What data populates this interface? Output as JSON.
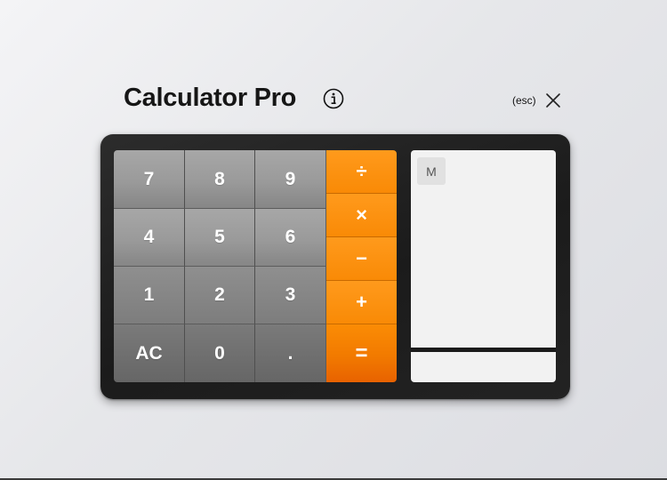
{
  "app": {
    "title": "Calculator Pro",
    "info_icon": "info-circle-icon",
    "esc_hint": "(esc)",
    "close_icon": "close-x-icon"
  },
  "keypad": {
    "digit_keys": [
      {
        "label": "7",
        "name": "key-7"
      },
      {
        "label": "8",
        "name": "key-8"
      },
      {
        "label": "9",
        "name": "key-9"
      },
      {
        "label": "4",
        "name": "key-4"
      },
      {
        "label": "5",
        "name": "key-5"
      },
      {
        "label": "6",
        "name": "key-6"
      },
      {
        "label": "1",
        "name": "key-1"
      },
      {
        "label": "2",
        "name": "key-2"
      },
      {
        "label": "3",
        "name": "key-3"
      },
      {
        "label": "AC",
        "name": "key-all-clear"
      },
      {
        "label": "0",
        "name": "key-0"
      },
      {
        "label": ".",
        "name": "key-decimal"
      }
    ],
    "operator_keys": [
      {
        "label": "÷",
        "name": "key-divide"
      },
      {
        "label": "×",
        "name": "key-multiply"
      },
      {
        "label": "−",
        "name": "key-subtract"
      },
      {
        "label": "+",
        "name": "key-add"
      },
      {
        "label": "=",
        "name": "key-equals"
      }
    ]
  },
  "display": {
    "memory_label": "M",
    "result": ""
  },
  "colors": {
    "operator_orange": "#f98a06",
    "digit_gray": "#9a9a9a",
    "device_dark": "#1f1f1f",
    "display_bg": "#f2f2f2"
  }
}
